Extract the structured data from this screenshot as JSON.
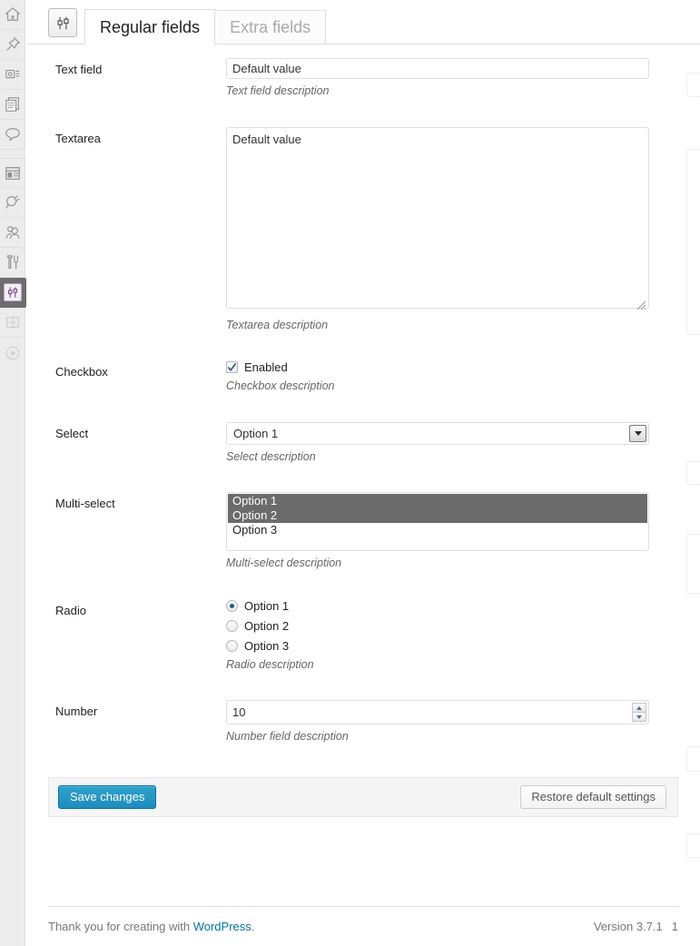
{
  "sidebar": {
    "items": [
      {
        "icon": "dashboard-home-icon",
        "current": false
      },
      {
        "icon": "pin-posts-icon",
        "current": false
      },
      {
        "icon": "media-camera-icon",
        "current": false
      },
      {
        "icon": "pages-documents-icon",
        "current": false
      },
      {
        "icon": "comments-bubble-icon",
        "current": false
      },
      {
        "icon": "appearance-layout-icon",
        "current": false
      },
      {
        "icon": "plugins-plug-icon",
        "current": false
      },
      {
        "icon": "users-people-icon",
        "current": false
      },
      {
        "icon": "tools-hammer-icon",
        "current": false
      },
      {
        "icon": "settings-sliders-icon",
        "current": true
      },
      {
        "icon": "collapse-panel-icon",
        "current": false
      },
      {
        "icon": "play-circle-icon",
        "current": false
      }
    ]
  },
  "header": {
    "logo_icon": "settings-sliders-icon",
    "tabs": [
      {
        "label": "Regular fields",
        "active": true
      },
      {
        "label": "Extra fields",
        "active": false
      }
    ]
  },
  "fields": {
    "text": {
      "label": "Text field",
      "value": "Default value",
      "description": "Text field description"
    },
    "textarea": {
      "label": "Textarea",
      "value": "Default value",
      "description": "Textarea description"
    },
    "checkbox": {
      "label": "Checkbox",
      "option_label": "Enabled",
      "checked": true,
      "description": "Checkbox description"
    },
    "select": {
      "label": "Select",
      "value": "Option 1",
      "options": [
        "Option 1",
        "Option 2",
        "Option 3"
      ],
      "description": "Select description"
    },
    "multiselect": {
      "label": "Multi-select",
      "options": [
        {
          "label": "Option 1",
          "selected": true
        },
        {
          "label": "Option 2",
          "selected": true
        },
        {
          "label": "Option 3",
          "selected": false
        }
      ],
      "description": "Multi-select description"
    },
    "radio": {
      "label": "Radio",
      "options": [
        {
          "label": "Option 1",
          "selected": true
        },
        {
          "label": "Option 2",
          "selected": false
        },
        {
          "label": "Option 3",
          "selected": false
        }
      ],
      "description": "Radio description"
    },
    "number": {
      "label": "Number",
      "value": "10",
      "description": "Number field description"
    }
  },
  "actions": {
    "save_label": "Save changes",
    "restore_label": "Restore default settings"
  },
  "footer": {
    "thanks_prefix": "Thank you for creating with ",
    "brand_link": "WordPress",
    "thanks_suffix": ".",
    "version": "Version 3.7.1",
    "extra": "1"
  },
  "colors": {
    "primary": "#2ea2cc",
    "link": "#0074a2",
    "current_menu_bg": "#6d6d6d",
    "multiselect_highlight": "#6b6b6b"
  }
}
